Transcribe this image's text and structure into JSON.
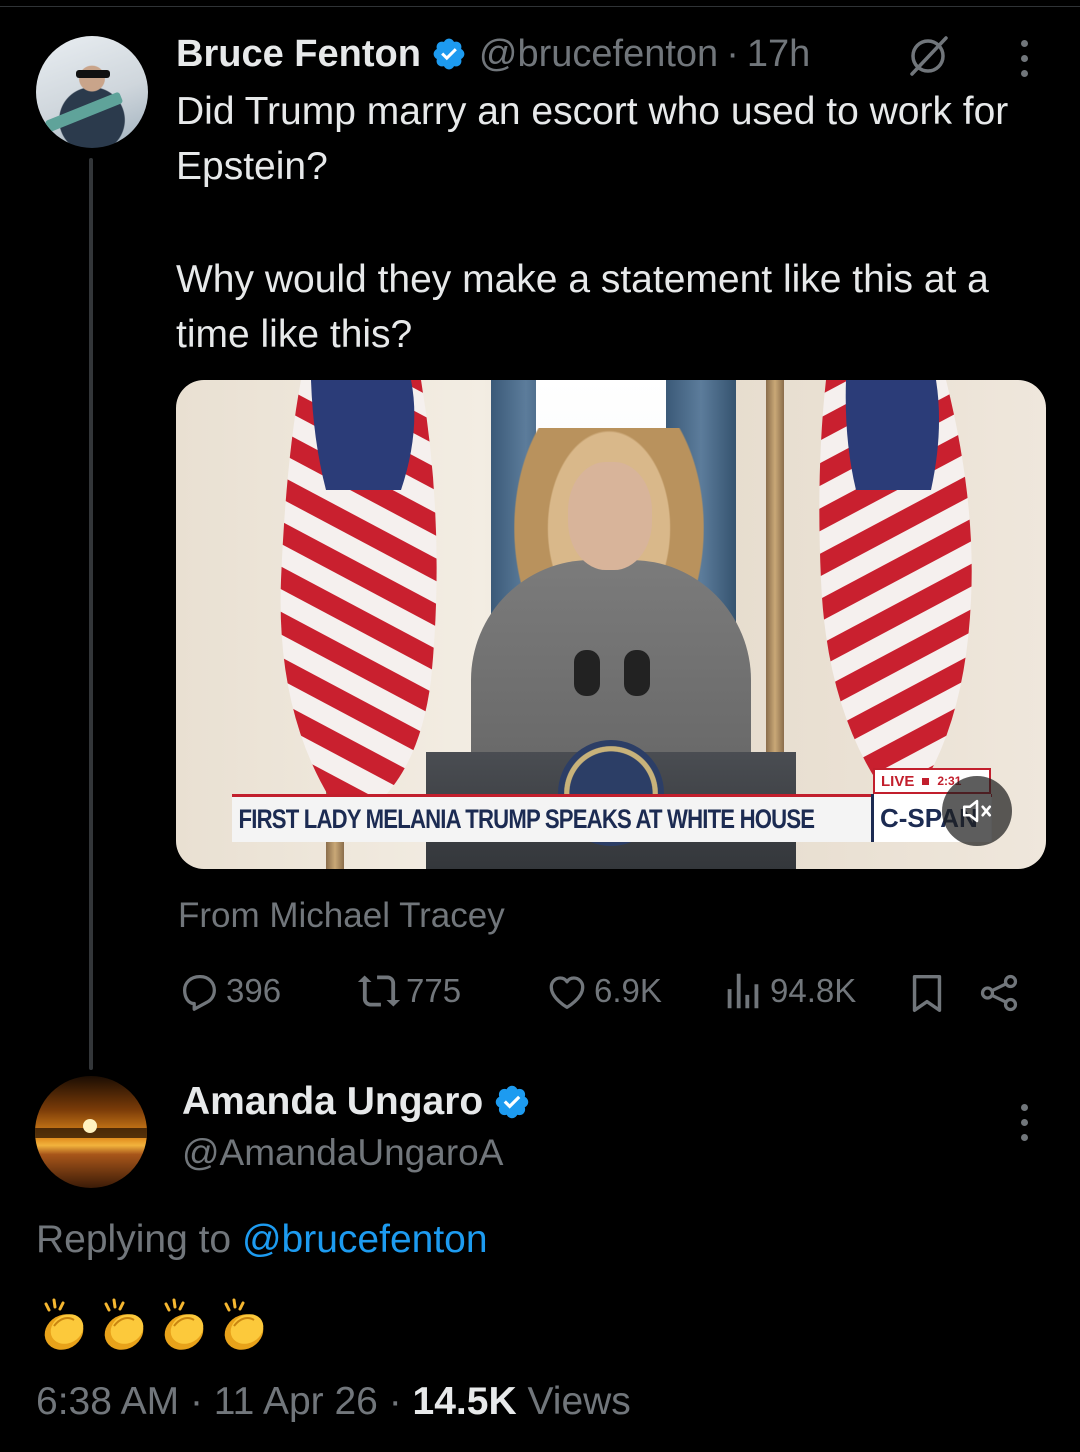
{
  "colors": {
    "background": "#000000",
    "text_primary": "#e7e9ea",
    "text_secondary": "#71767b",
    "link": "#1d9bf0",
    "verified_badge": "#1d9bf0"
  },
  "tweet": {
    "author_name": "Bruce Fenton",
    "author_handle": "@brucefenton",
    "separator": "·",
    "time": "17h",
    "verified_icon": "verified-badge-icon",
    "grok_icon": "grok-icon",
    "more_icon": "more-dots-icon",
    "text_line_1": "Did Trump marry an escort who used to work for Epstein?",
    "text_line_2": "Why would they make a statement like this at a time like this?",
    "media": {
      "lower_third": "FIRST LADY MELANIA TRUMP SPEAKS AT WHITE HOUSE",
      "network": "C-SPAN",
      "live_label": "LIVE",
      "clock": "2:31",
      "mute_icon": "speaker-muted-icon"
    },
    "attribution": "From Michael Tracey",
    "stats": {
      "replies": "396",
      "reposts": "775",
      "likes": "6.9K",
      "views": "94.8K"
    }
  },
  "reply": {
    "author_name": "Amanda Ungaro",
    "author_handle": "@AmandaUngaroA",
    "replying_prefix": "Replying to",
    "replying_to": "@brucefenton",
    "emoji_content": "👏👏👏👏",
    "emoji_count": 4,
    "timestamp": "6:38 AM",
    "separator": "·",
    "date": "11 Apr 26",
    "views_count": "14.5K",
    "views_label": "Views"
  }
}
